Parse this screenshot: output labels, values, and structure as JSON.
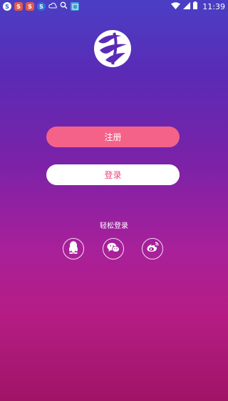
{
  "status_bar": {
    "apps": [
      "S",
      "S",
      "S",
      "S"
    ],
    "time": "11:39"
  },
  "buttons": {
    "register": "注册",
    "login": "登录"
  },
  "easy_login": {
    "label": "轻松登录",
    "providers": [
      {
        "name": "QQ",
        "icon": "qq-icon"
      },
      {
        "name": "WeChat",
        "icon": "wechat-icon"
      },
      {
        "name": "Weibo",
        "icon": "weibo-icon"
      }
    ]
  },
  "colors": {
    "register_button": "#f4628a",
    "login_text": "#e84a82",
    "background_top": "#4a3fc4",
    "background_bottom": "#a01466"
  }
}
